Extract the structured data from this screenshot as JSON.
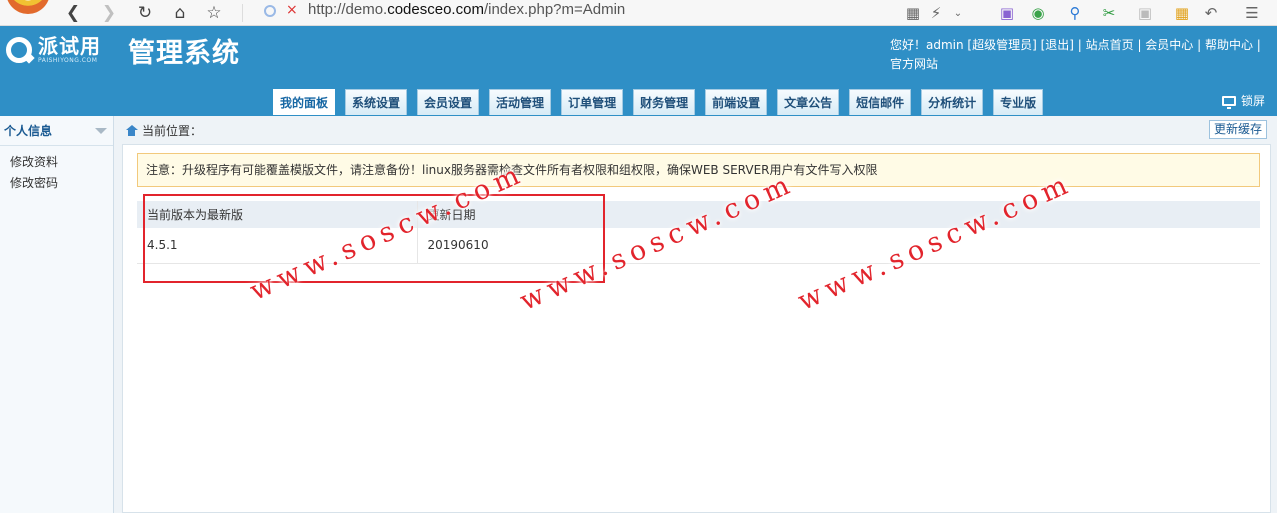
{
  "browser": {
    "url_prefix": "http://demo.",
    "url_host": "codesceo.com",
    "url_path": "/index.php?m=Admin"
  },
  "header": {
    "brand_cn": "派试用",
    "brand_en": "PAISHIYONG.COM",
    "system_title": "管理系统",
    "greeting": "您好！admin [超级管理员] [退出] | 站点首页 | 会员中心 | 帮助中心 | 官方网站",
    "tabs": [
      {
        "label": "我的面板",
        "active": true
      },
      {
        "label": "系统设置"
      },
      {
        "label": "会员设置"
      },
      {
        "label": "活动管理"
      },
      {
        "label": "订单管理"
      },
      {
        "label": "财务管理"
      },
      {
        "label": "前端设置"
      },
      {
        "label": "文章公告"
      },
      {
        "label": "短信邮件"
      },
      {
        "label": "分析统计"
      },
      {
        "label": "专业版"
      }
    ],
    "lock_label": "锁屏"
  },
  "sidebar": {
    "title": "个人信息",
    "items": [
      {
        "label": "修改资料"
      },
      {
        "label": "修改密码"
      }
    ]
  },
  "main": {
    "breadcrumb_label": "当前位置：",
    "refresh_button": "更新缓存",
    "notice": "注意：升级程序有可能覆盖模版文件，请注意备份！linux服务器需检查文件所有者权限和组权限，确保WEB SERVER用户有文件写入权限",
    "version_table": {
      "headers": [
        "当前版本为最新版",
        "更新日期",
        ""
      ],
      "rows": [
        [
          "4.5.1",
          "20190610",
          ""
        ]
      ]
    }
  },
  "watermark": "www.soscw.com"
}
